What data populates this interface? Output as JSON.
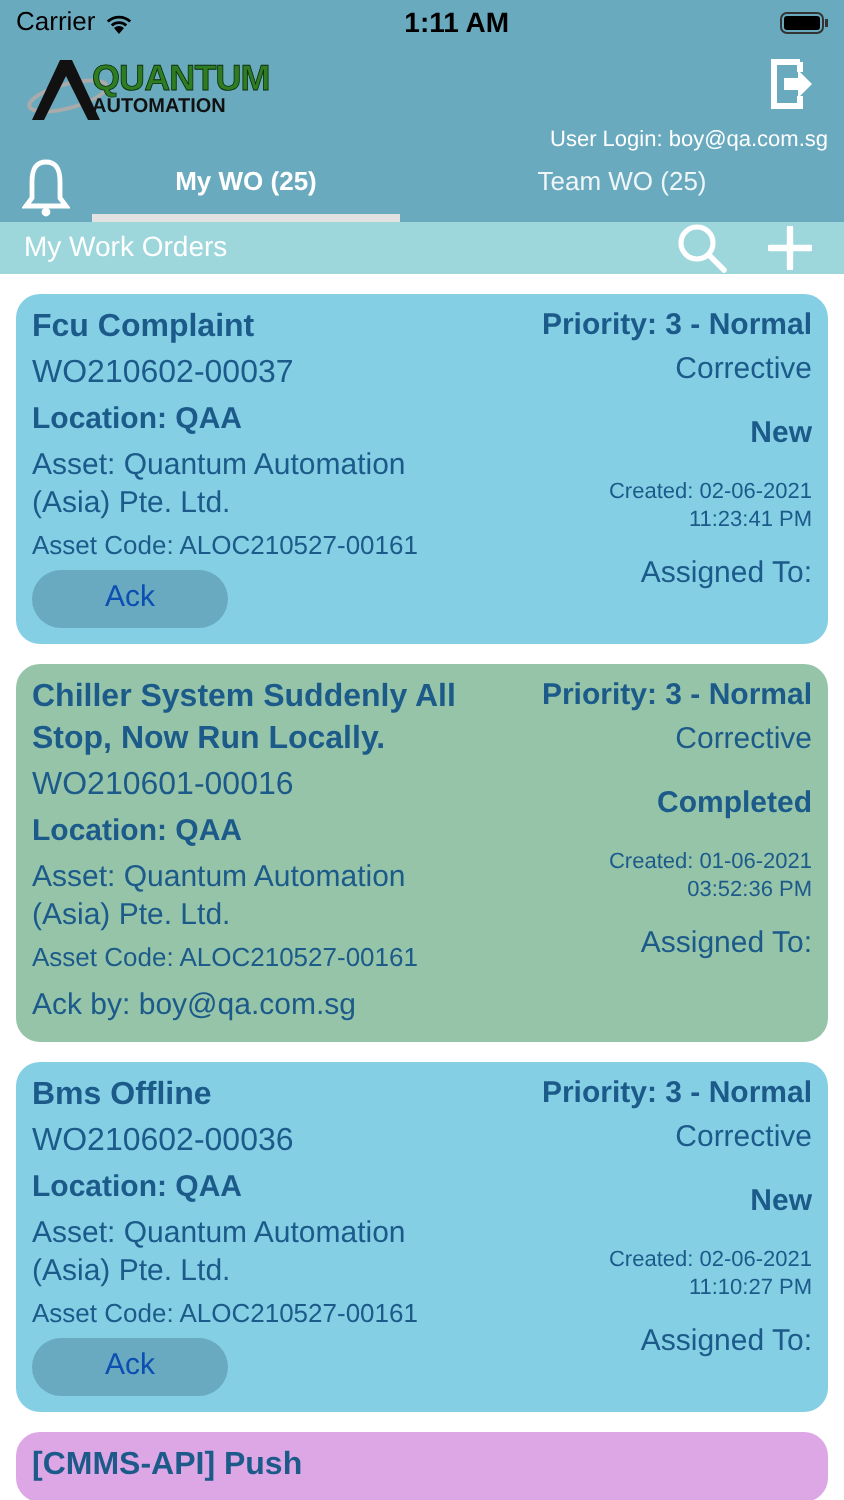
{
  "status_bar": {
    "carrier": "Carrier",
    "time": "1:11 AM"
  },
  "header": {
    "logo_top": "QUANTUM",
    "logo_bottom": "AUTOMATION",
    "user_login": "User Login: boy@qa.com.sg"
  },
  "tabs": [
    {
      "label": "My WO (25)",
      "selected": true
    },
    {
      "label": "Team WO (25)",
      "selected": false
    }
  ],
  "toolbar": {
    "title": "My Work Orders"
  },
  "work_orders": [
    {
      "color": "#84cfe4",
      "title": "Fcu Complaint",
      "number": "WO210602-00037",
      "location": "Location: QAA",
      "asset": "Asset: Quantum Automation (Asia) Pte. Ltd.",
      "asset_code": "Asset Code: ALOC210527-00161",
      "ack_button": "Ack",
      "priority": "Priority: 3 - Normal",
      "type": "Corrective",
      "status": "New",
      "created": "Created: 02-06-2021",
      "created_time": "11:23:41 PM",
      "assigned": "Assigned To:"
    },
    {
      "color": "#95c4a9",
      "title": "Chiller System Suddenly All Stop, Now Run Locally.",
      "number": "WO210601-00016",
      "location": "Location: QAA",
      "asset": "Asset: Quantum Automation (Asia) Pte. Ltd.",
      "asset_code": "Asset Code: ALOC210527-00161",
      "ack_by": "Ack by: boy@qa.com.sg",
      "priority": "Priority: 3 - Normal",
      "type": "Corrective",
      "status": "Completed",
      "created": "Created: 01-06-2021",
      "created_time": "03:52:36 PM",
      "assigned": "Assigned To:"
    },
    {
      "color": "#84cfe4",
      "title": "Bms Offline",
      "number": "WO210602-00036",
      "location": "Location: QAA",
      "asset": "Asset: Quantum Automation (Asia) Pte. Ltd.",
      "asset_code": "Asset Code: ALOC210527-00161",
      "ack_button": "Ack",
      "priority": "Priority: 3 - Normal",
      "type": "Corrective",
      "status": "New",
      "created": "Created: 02-06-2021",
      "created_time": "11:10:27 PM",
      "assigned": "Assigned To:"
    },
    {
      "color": "#dda7e6",
      "title": "[CMMS-API] Push"
    }
  ]
}
